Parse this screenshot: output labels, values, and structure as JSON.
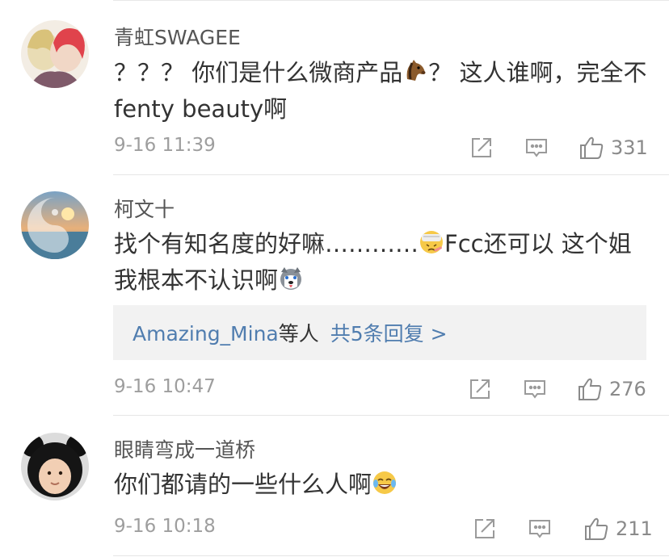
{
  "comments": [
    {
      "username": "青虹SWAGEE",
      "text_1": "？？？ 你们是什么微商产品",
      "emoji_1": "horse-face",
      "text_2": "？ 这人谁啊，完全不fenty beauty啊",
      "timestamp": "9-16 11:39",
      "likes": "331"
    },
    {
      "username": "柯文十",
      "text_1": "找个有知名度的好嘛…………",
      "emoji_1": "sick-face",
      "text_2": "Fcc还可以 这个姐我根本不认识啊",
      "emoji_2": "husky-dog",
      "reply_users": "Amazing_Mina",
      "reply_suffix": "等人",
      "reply_count": "共5条回复 >",
      "timestamp": "9-16 10:47",
      "likes": "276"
    },
    {
      "username": "眼睛弯成一道桥",
      "text_1": "你们都请的一些什么人啊",
      "emoji_1": "laughing-crying",
      "timestamp": "9-16 10:18",
      "likes": "211"
    }
  ],
  "colors": {
    "link_blue": "#507daf",
    "meta_gray": "#9e9e9e",
    "reply_bg": "#f2f2f2",
    "text": "#333333"
  }
}
